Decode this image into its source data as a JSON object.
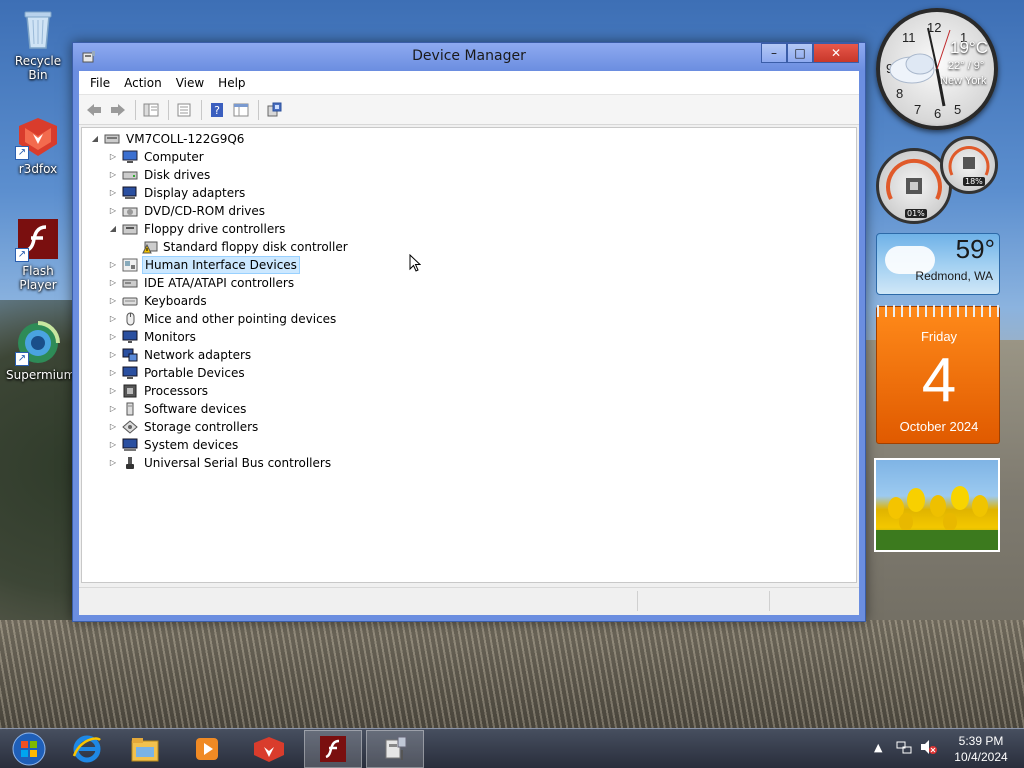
{
  "desktop": {
    "icons": [
      {
        "label": "Recycle Bin"
      },
      {
        "label": "r3dfox"
      },
      {
        "label": "Flash Player"
      },
      {
        "label": "Supermium"
      }
    ]
  },
  "window": {
    "title": "Device Manager",
    "buttons": {
      "minimize": "–",
      "maximize": "□",
      "close": "✕"
    }
  },
  "menubar": {
    "items": [
      "File",
      "Action",
      "View",
      "Help"
    ]
  },
  "toolbar": {
    "buttons": [
      "back-icon",
      "forward-icon",
      "show-hide-tree-icon",
      "properties-icon",
      "help-icon",
      "view-icon",
      "scan-hardware-icon"
    ]
  },
  "tree": {
    "root": "VM7COLL-122G9Q6",
    "categories": [
      {
        "label": "Computer",
        "expanded": false
      },
      {
        "label": "Disk drives",
        "expanded": false
      },
      {
        "label": "Display adapters",
        "expanded": false
      },
      {
        "label": "DVD/CD-ROM drives",
        "expanded": false
      },
      {
        "label": "Floppy drive controllers",
        "expanded": true
      },
      {
        "label": "Human Interface Devices",
        "expanded": false,
        "selected": true
      },
      {
        "label": "IDE ATA/ATAPI controllers",
        "expanded": false
      },
      {
        "label": "Keyboards",
        "expanded": false
      },
      {
        "label": "Mice and other pointing devices",
        "expanded": false
      },
      {
        "label": "Monitors",
        "expanded": false
      },
      {
        "label": "Network adapters",
        "expanded": false
      },
      {
        "label": "Portable Devices",
        "expanded": false
      },
      {
        "label": "Processors",
        "expanded": false
      },
      {
        "label": "Software devices",
        "expanded": false
      },
      {
        "label": "Storage controllers",
        "expanded": false
      },
      {
        "label": "System devices",
        "expanded": false
      },
      {
        "label": "Universal Serial Bus controllers",
        "expanded": false
      }
    ],
    "floppy_child": "Standard floppy disk controller"
  },
  "gadgets": {
    "clock_weather": {
      "temp": "19°C",
      "range": "22° / 9°",
      "city": "New York"
    },
    "meters": {
      "cpu": "01%",
      "ram": "18%"
    },
    "weather": {
      "temp": "59°",
      "city": "Redmond, WA"
    },
    "calendar": {
      "weekday": "Friday",
      "day": "4",
      "month_year": "October 2024"
    }
  },
  "taskbar": {
    "items": [
      "start-button",
      "internet-explorer",
      "file-explorer",
      "media-player",
      "r3dfox",
      "flash-player",
      "device-manager"
    ],
    "time": "5:39 PM",
    "date": "10/4/2024"
  },
  "colors": {
    "selection_bg": "#cce8ff",
    "selection_border": "#99d1ff",
    "window_frame": "#6b8ee0",
    "close_button": "#c7372a",
    "calendar_orange": "#ff8a1a"
  }
}
